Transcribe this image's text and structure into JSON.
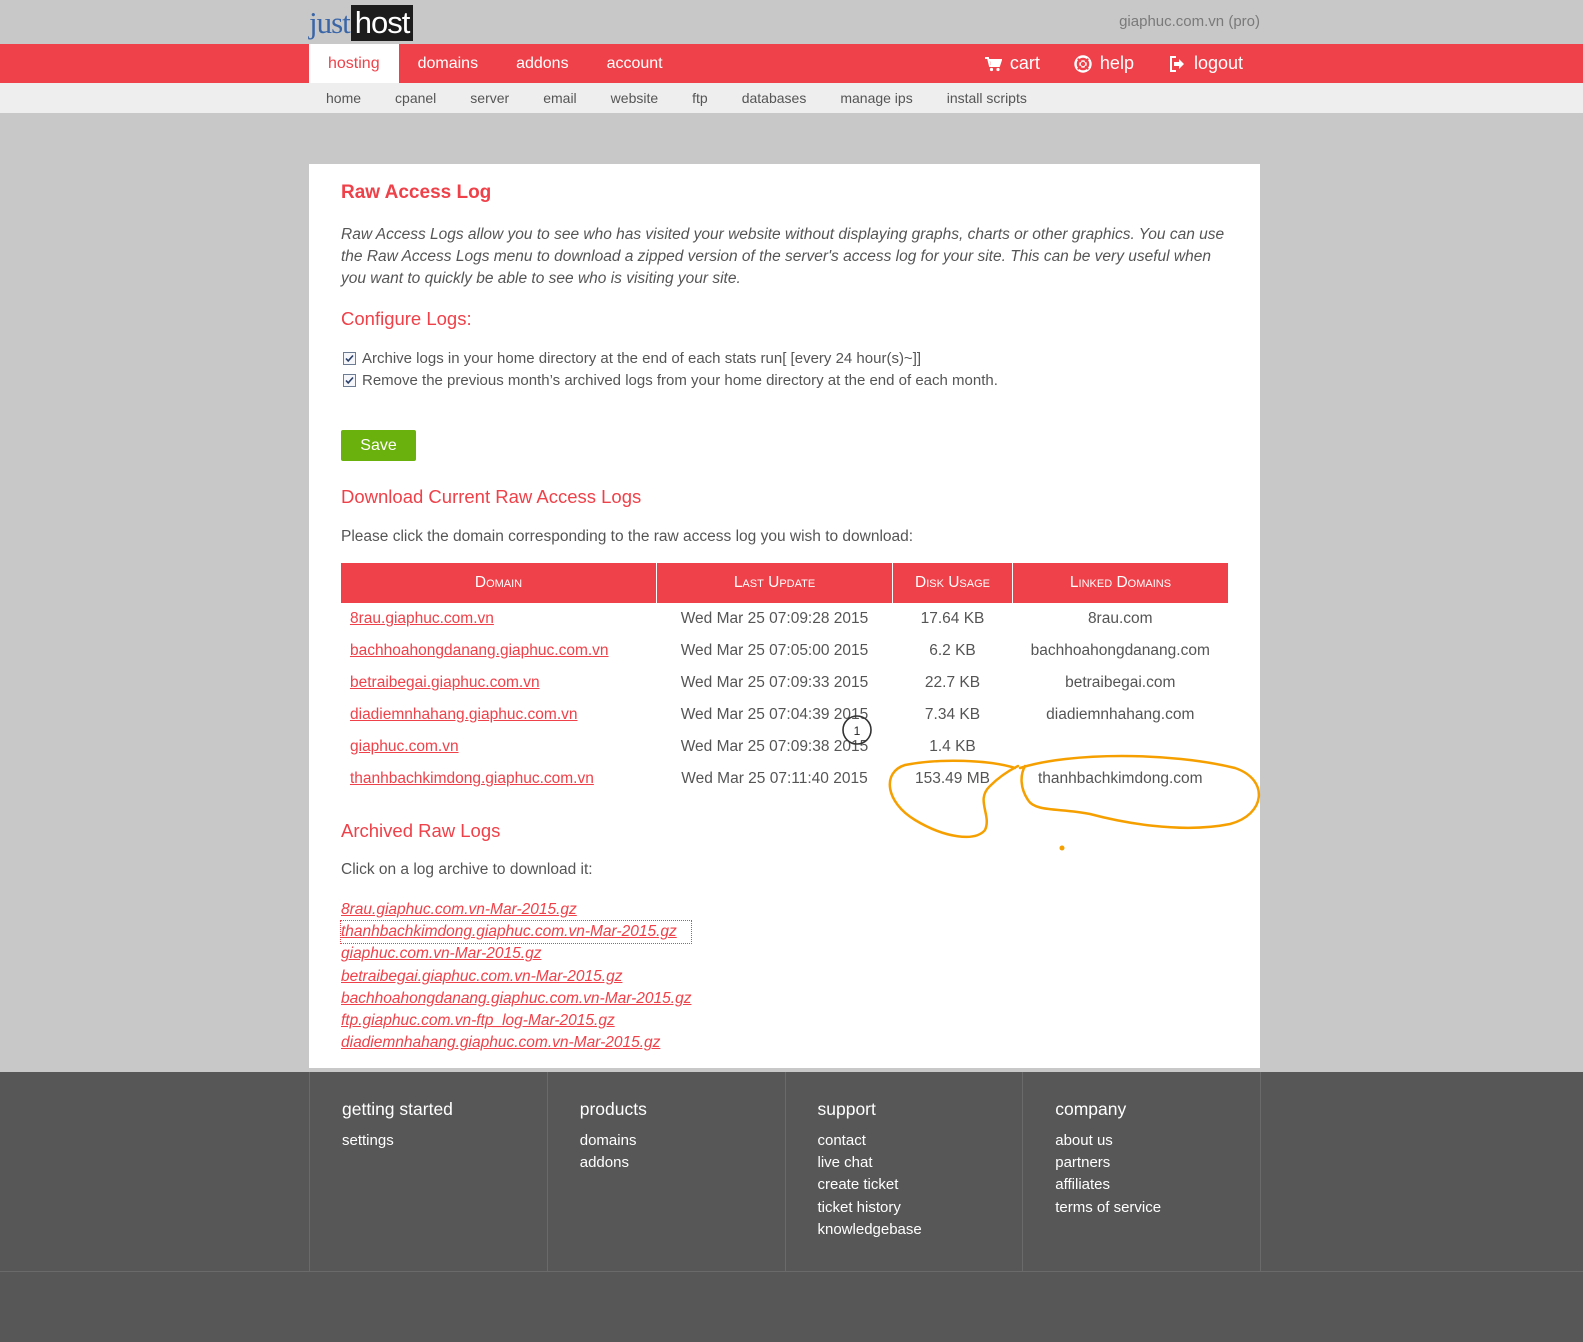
{
  "header": {
    "logo_just": "just",
    "logo_host": "host",
    "account": "giaphuc.com.vn (pro)"
  },
  "main_nav": {
    "left": [
      "hosting",
      "domains",
      "addons",
      "account"
    ],
    "right": {
      "cart": "cart",
      "help": "help",
      "logout": "logout"
    },
    "icons": {
      "cart": "cart-icon",
      "help": "lifebuoy-icon",
      "logout": "logout-icon"
    }
  },
  "sub_nav": [
    "home",
    "cpanel",
    "server",
    "email",
    "website",
    "ftp",
    "databases",
    "manage ips",
    "install scripts"
  ],
  "page": {
    "title": "Raw Access Log",
    "intro": "Raw Access Logs allow you to see who has visited your website without displaying graphs, charts or other graphics. You can use the Raw Access Logs menu to download a zipped version of the server's access log for your site. This can be very useful when you want to quickly be able to see who is visiting your site.",
    "configure_heading": "Configure Logs:",
    "options": [
      {
        "label": "Archive logs in your home directory at the end of each stats run[ [every 24 hour(s)~]]",
        "checked": true
      },
      {
        "label": "Remove the previous month’s archived logs from your home directory at the end of each month.",
        "checked": true
      }
    ],
    "save_label": "Save",
    "download_heading": "Download Current Raw Access Logs",
    "download_instructions": "Please click the domain corresponding to the raw access log you wish to download:",
    "table": {
      "headers": [
        "Domain",
        "Last Update",
        "Disk Usage",
        "Linked Domains"
      ],
      "rows": [
        {
          "domain": "8rau.giaphuc.com.vn",
          "last_update": "Wed Mar 25 07:09:28 2015",
          "disk_usage": "17.64 KB",
          "linked": "8rau.com"
        },
        {
          "domain": "bachhoahongdanang.giaphuc.com.vn",
          "last_update": "Wed Mar 25 07:05:00 2015",
          "disk_usage": "6.2 KB",
          "linked": "bachhoahongdanang.com"
        },
        {
          "domain": "betraibegai.giaphuc.com.vn",
          "last_update": "Wed Mar 25 07:09:33 2015",
          "disk_usage": "22.7 KB",
          "linked": "betraibegai.com"
        },
        {
          "domain": "diadiemnhahang.giaphuc.com.vn",
          "last_update": "Wed Mar 25 07:04:39 2015",
          "disk_usage": "7.34 KB",
          "linked": "diadiemnhahang.com"
        },
        {
          "domain": "giaphuc.com.vn",
          "last_update": "Wed Mar 25 07:09:38 2015",
          "disk_usage": "1.4 KB",
          "linked": ""
        },
        {
          "domain": "thanhbachkimdong.giaphuc.com.vn",
          "last_update": "Wed Mar 25 07:11:40 2015",
          "disk_usage": "153.49 MB",
          "linked": "thanhbachkimdong.com"
        }
      ]
    },
    "archived_heading": "Archived Raw Logs",
    "archived_instructions": "Click on a log archive to download it:",
    "archives": [
      "8rau.giaphuc.com.vn-Mar-2015.gz",
      "thanhbachkimdong.giaphuc.com.vn-Mar-2015.gz",
      "giaphuc.com.vn-Mar-2015.gz",
      "betraibegai.giaphuc.com.vn-Mar-2015.gz",
      "bachhoahongdanang.giaphuc.com.vn-Mar-2015.gz",
      "ftp.giaphuc.com.vn-ftp_log-Mar-2015.gz",
      "diadiemnhahang.giaphuc.com.vn-Mar-2015.gz"
    ]
  },
  "annotation": {
    "marker": "1",
    "color": "#f5a000"
  },
  "footer": {
    "columns": [
      {
        "heading": "getting started",
        "links": [
          "settings"
        ]
      },
      {
        "heading": "products",
        "links": [
          "domains",
          "addons"
        ]
      },
      {
        "heading": "support",
        "links": [
          "contact",
          "live chat",
          "create ticket",
          "ticket history",
          "knowledgebase"
        ]
      },
      {
        "heading": "company",
        "links": [
          "about us",
          "partners",
          "affiliates",
          "terms of service"
        ]
      }
    ]
  },
  "colors": {
    "brand_red": "#ef4149",
    "save_green": "#6bb10e",
    "footer_bg": "#575757",
    "page_bg": "#c8c8c8"
  }
}
